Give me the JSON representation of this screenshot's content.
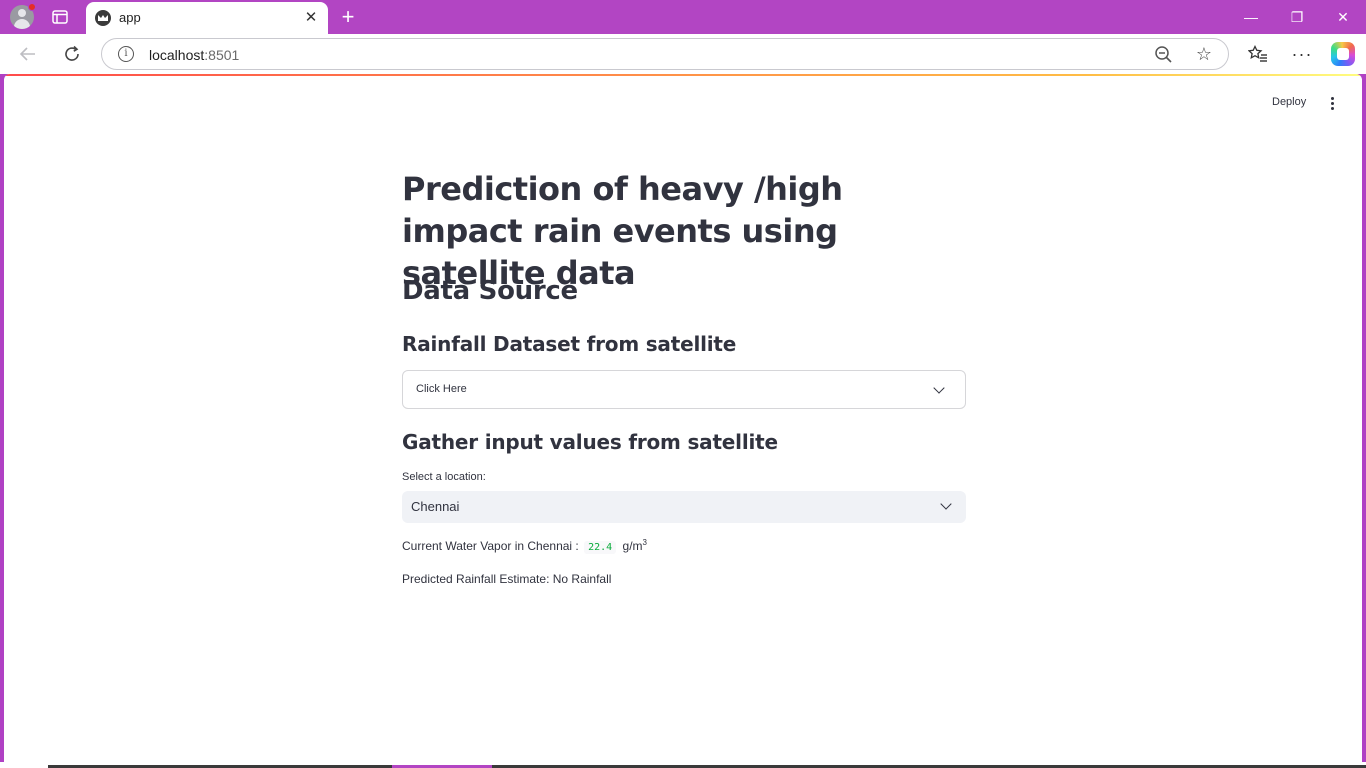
{
  "browser": {
    "tab_title": "app",
    "tab_close": "✕",
    "new_tab": "+",
    "url_host": "localhost",
    "url_port": ":8501",
    "window_controls": {
      "minimize": "—",
      "restore": "❐",
      "close": "✕"
    }
  },
  "app": {
    "deploy_label": "Deploy",
    "title": "Prediction of heavy /high impact rain events using satellite data",
    "data_source_heading": "Data Source",
    "rainfall_heading": "Rainfall Dataset from satellite",
    "expander_label": "Click Here",
    "gather_heading": "Gather input values from satellite",
    "location_label": "Select a location:",
    "location_value": "Chennai",
    "water_vapor_prefix": "Current Water Vapor in Chennai :",
    "water_vapor_value": "22.4",
    "water_vapor_unit": "g/m",
    "water_vapor_unit_exp": "3",
    "prediction_text": "Predicted Rainfall Estimate: No Rainfall"
  },
  "colors": {
    "titlebar": "#b245c3",
    "text": "#31333f",
    "code_value": "#09ab3b",
    "select_bg": "#f0f2f6"
  }
}
